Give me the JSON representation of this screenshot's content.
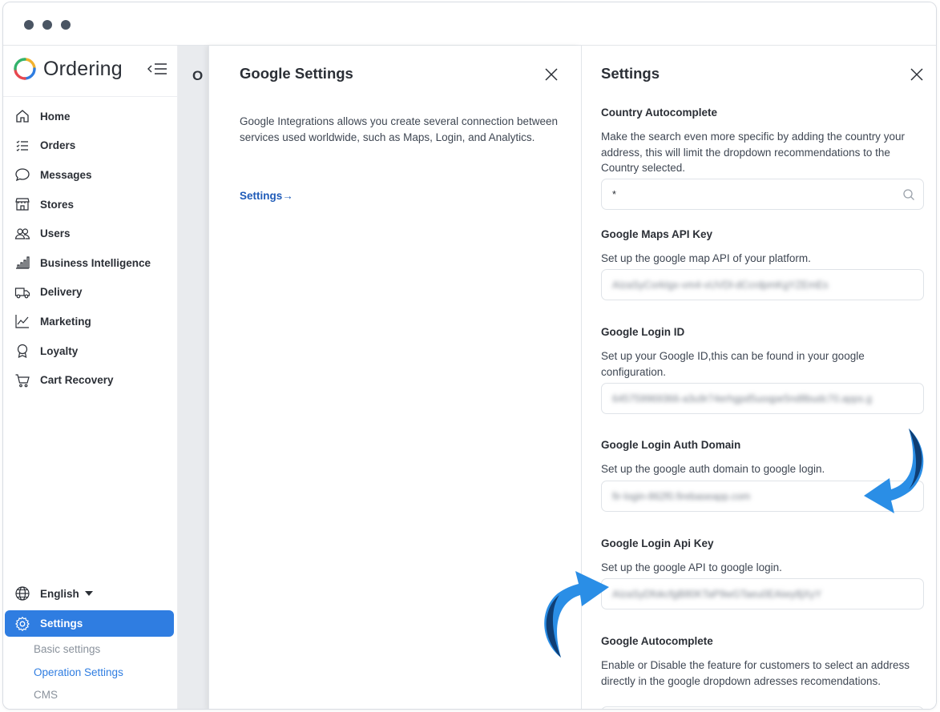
{
  "colors": {
    "accent": "#2f7de1",
    "link": "#1f5bb8",
    "arrow": "#2a8ee6",
    "arrow_dark": "#0f3e74"
  },
  "brand": {
    "name": "Ordering"
  },
  "sidebar": {
    "items": [
      {
        "label": "Home",
        "icon": "home-icon"
      },
      {
        "label": "Orders",
        "icon": "list-icon"
      },
      {
        "label": "Messages",
        "icon": "chat-icon"
      },
      {
        "label": "Stores",
        "icon": "store-icon"
      },
      {
        "label": "Users",
        "icon": "users-icon"
      },
      {
        "label": "Business Intelligence",
        "icon": "bar-chart-icon"
      },
      {
        "label": "Delivery",
        "icon": "truck-icon"
      },
      {
        "label": "Marketing",
        "icon": "line-chart-icon"
      },
      {
        "label": "Loyalty",
        "icon": "award-icon"
      },
      {
        "label": "Cart Recovery",
        "icon": "cart-icon"
      }
    ],
    "language": "English",
    "settings_label": "Settings",
    "sub_items": [
      "Basic settings",
      "Operation Settings",
      "CMS"
    ]
  },
  "background_page": {
    "title_fragment": "O"
  },
  "google_panel": {
    "title": "Google Settings",
    "description": "Google Integrations allows you create several connection between services used worldwide, such as Maps, Login, and Analytics.",
    "link": "Settings→"
  },
  "settings_panel": {
    "title": "Settings",
    "fields": [
      {
        "title": "Country Autocomplete",
        "description": "Make the search even more specific by adding the country your address, this will limit the dropdown recommendations to the Country selected.",
        "value": "*"
      },
      {
        "title": "Google Maps API Key",
        "description": "Set up the google map API of your platform.",
        "value": "AIzaSyCorkIgx-vm4-vUVDl-dCcrdpmKgYZEmEs"
      },
      {
        "title": "Google Login ID",
        "description": "Set up your Google ID,this can be found in your google configuration.",
        "value": "645759969366-a3u9r74erhgpd5uoqpe5nd8budc70.apps.g"
      },
      {
        "title": "Google Login Auth Domain",
        "description": "Set up the google auth domain to google login.",
        "value": "fir-login-862f0.firebaseapp.com"
      },
      {
        "title": "Google Login Api Key",
        "description": "Set up the google API to google login.",
        "value": "AIzaSyDfokcfgB80KTaP9wGTaeu0EAiwy8jXyY"
      },
      {
        "title": "Google Autocomplete",
        "description": "Enable or Disable the feature for customers to select an address directly in the google dropdown adresses recomendations."
      }
    ]
  }
}
